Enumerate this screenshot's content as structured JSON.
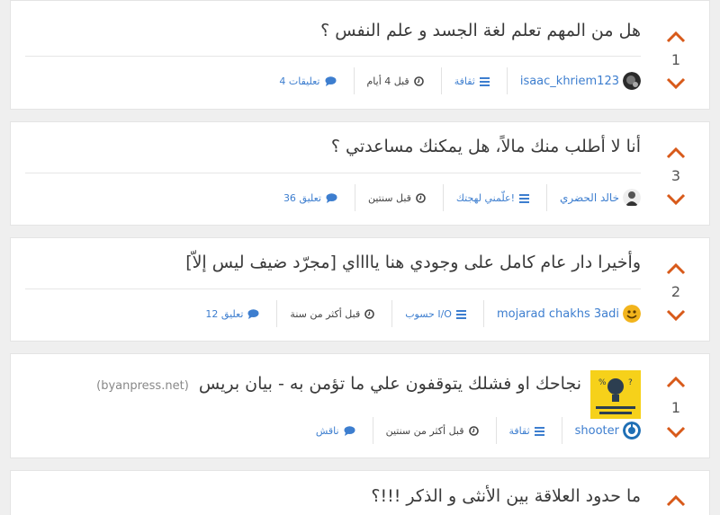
{
  "colors": {
    "accent": "#d85a1a",
    "link": "#3d7ecf",
    "background": "#efefef",
    "card": "#ffffff"
  },
  "posts": [
    {
      "title": "هل من المهم تعلم لغة الجسد و علم النفس ؟",
      "votes": "1",
      "author": "isaac_khriem123",
      "category": "ثقافة",
      "time": "قبل 4 أيام",
      "comments": "4 تعليقات",
      "icons": {
        "up": "chevron-up-icon",
        "down": "chevron-down-icon",
        "category": "list-icon",
        "time": "clock-icon",
        "comments": "comment-icon"
      }
    },
    {
      "title": "أنا لا أطلب منك مالاً، هل يمكنك مساعدتي ؟",
      "votes": "3",
      "author": "خالد الحضري",
      "category": "علّمني لهجتك!",
      "time": "قبل سنتين",
      "comments": "36 تعليق"
    },
    {
      "title": "وأخيرا دار عام كامل على وجودي هنا يااااي [مجرّد ضيف ليس إلاّ]",
      "votes": "2",
      "author": "mojarad chakhs 3adi",
      "category": "حسوب I/O",
      "time": "قبل أكثر من سنة",
      "comments": "12 تعليق"
    },
    {
      "title": "نجاحك او فشلك يتوقفون علي ما تؤمن به - بيان بريس",
      "domain": "(byanpress.net)",
      "votes": "1",
      "author": "shooter",
      "category": "ثقافة",
      "time": "قبل أكثر من سنتين",
      "comments": "ناقش"
    },
    {
      "title": "ما حدود العلاقة بين الأنثى و الذكر !!!؟"
    }
  ]
}
